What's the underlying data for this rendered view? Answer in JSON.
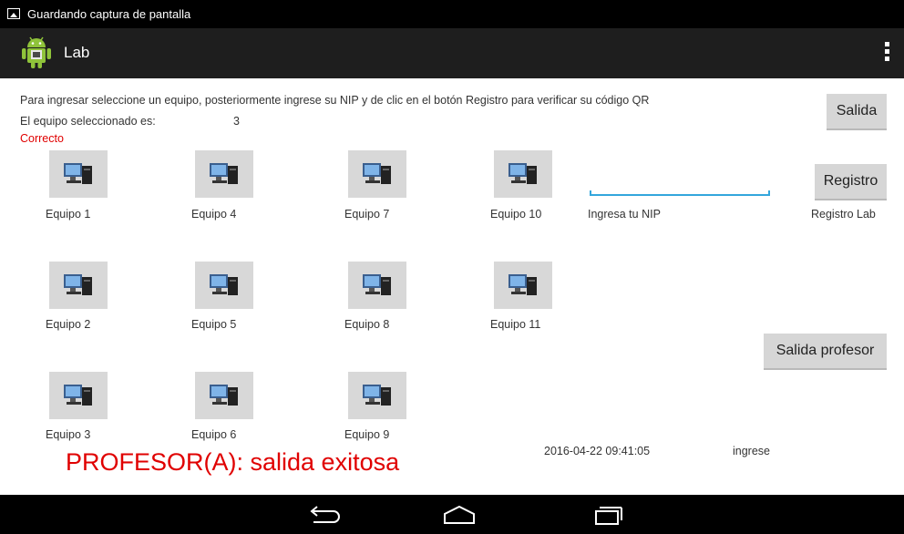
{
  "status_bar": {
    "notification_text": "Guardando captura de pantalla"
  },
  "action_bar": {
    "title": "Lab",
    "app_icon": "android-icon",
    "menu_icon": "overflow-menu-icon"
  },
  "instructions": "Para ingresar seleccione un equipo, posteriormente ingrese su NIP y de clic en el botón Registro para verificar su código QR",
  "selection": {
    "label": "El equipo seleccionado es:",
    "value": "3"
  },
  "status_message": "Correcto",
  "buttons": {
    "salida": "Salida",
    "registro": "Registro",
    "salida_profesor": "Salida profesor"
  },
  "equipos": [
    {
      "label": "Equipo 1"
    },
    {
      "label": "Equipo 2"
    },
    {
      "label": "Equipo 3"
    },
    {
      "label": "Equipo 4"
    },
    {
      "label": "Equipo 5"
    },
    {
      "label": "Equipo 6"
    },
    {
      "label": "Equipo 7"
    },
    {
      "label": "Equipo 8"
    },
    {
      "label": "Equipo 9"
    },
    {
      "label": "Equipo 10"
    },
    {
      "label": "Equipo 11"
    }
  ],
  "nip": {
    "label": "Ingresa tu NIP",
    "value": ""
  },
  "registro_lab": "Registro Lab",
  "result_message": "PROFESOR(A): salida exitosa",
  "timestamp": "2016-04-22 09:41:05",
  "hint": "ingrese",
  "colors": {
    "error_red": "#e00000",
    "accent_blue": "#33a6dc",
    "action_bar": "#1e1e1e"
  },
  "nav_bar": {
    "icons": [
      "back-icon",
      "home-icon",
      "recents-icon"
    ]
  }
}
